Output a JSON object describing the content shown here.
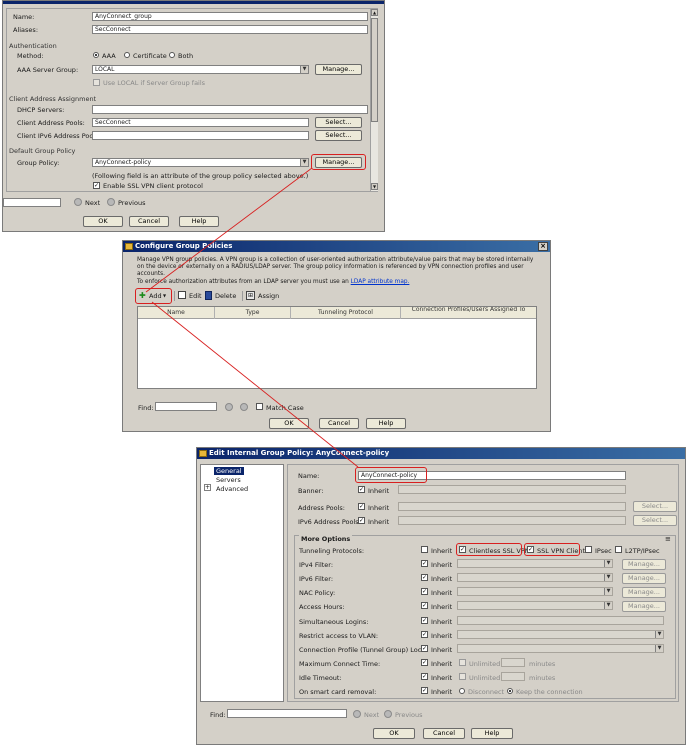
{
  "top_dialog": {
    "fields": {
      "name_label": "Name:",
      "name_value": "AnyConnect_group",
      "aliases_label": "Aliases:",
      "aliases_value": "SecConnect"
    },
    "authentication": {
      "section": "Authentication",
      "method_label": "Method:",
      "method_options": [
        "AAA",
        "Certificate",
        "Both"
      ],
      "method_selected": "AAA",
      "aaa_group_label": "AAA Server Group:",
      "aaa_group_value": "LOCAL",
      "manage_label": "Manage...",
      "fallback_label": "Use LOCAL if Server Group fails"
    },
    "client_address": {
      "section": "Client Address Assignment",
      "dhcp_label": "DHCP Servers:",
      "dhcp_value": "",
      "pools_label": "Client Address Pools:",
      "pools_value": "SecConnect",
      "ipv6_label": "Client IPv6 Address Pools:",
      "ipv6_value": "",
      "select_label": "Select..."
    },
    "default_group_policy": {
      "section": "Default Group Policy",
      "policy_label": "Group Policy:",
      "policy_value": "AnyConnect-policy",
      "manage_label": "Manage...",
      "note": "(Following field is an attribute of the group policy selected above.)",
      "ssl_label": "Enable SSL VPN client protocol"
    },
    "find": {
      "next_label": "Next",
      "previous_label": "Previous"
    },
    "buttons": {
      "ok": "OK",
      "cancel": "Cancel",
      "help": "Help"
    }
  },
  "group_policies": {
    "title": "Configure Group Policies",
    "description": "Manage VPN group policies. A VPN group is a collection of user-oriented authorization attribute/value pairs that may be stored internally on the device or externally on a RADIUS/LDAP server. The group policy information is referenced by VPN connection profiles and user accounts.",
    "ldap_text": "To enforce authorization attributes from an LDAP server you must use an",
    "ldap_link": "LDAP attribute map.",
    "toolbar": {
      "add": "Add",
      "edit": "Edit",
      "delete": "Delete",
      "assign": "Assign"
    },
    "columns": [
      "Name",
      "Type",
      "Tunneling Protocol",
      "Connection Profiles/Users Assigned To"
    ],
    "find_label": "Find:",
    "match_case": "Match Case",
    "buttons": {
      "ok": "OK",
      "cancel": "Cancel",
      "help": "Help"
    }
  },
  "edit_policy": {
    "title": "Edit Internal Group Policy: AnyConnect-policy",
    "nav": {
      "general": "General",
      "servers": "Servers",
      "advanced": "Advanced"
    },
    "name_label": "Name:",
    "name_value": "AnyConnect-policy",
    "banner_label": "Banner:",
    "address_pools_label": "Address Pools:",
    "ipv6_pools_label": "IPv6 Address Pools:",
    "inherit": "Inherit",
    "select": "Select...",
    "manage": "Manage...",
    "more_options": "More Options",
    "rows": {
      "tunneling": "Tunneling Protocols:",
      "ipv4": "IPv4 Filter:",
      "ipv6": "IPv6 Filter:",
      "nac": "NAC Policy:",
      "access_hours": "Access Hours:",
      "simultaneous": "Simultaneous Logins:",
      "vlan": "Restrict access to VLAN:",
      "lock": "Connection Profile (Tunnel Group) Lock:",
      "max_time": "Maximum Connect Time:",
      "idle": "Idle Timeout:",
      "smart_card": "On smart card removal:"
    },
    "protocols": {
      "clientless": "Clientless SSL VPN",
      "ssl_client": "SSL VPN Client",
      "ipsec": "IPsec",
      "l2tp": "L2TP/IPsec"
    },
    "unlimited": "Unlimited",
    "minutes": "minutes",
    "disconnect": "Disconnect",
    "keep": "Keep the connection",
    "find_label": "Find:",
    "next_label": "Next",
    "previous_label": "Previous",
    "buttons": {
      "ok": "OK",
      "cancel": "Cancel",
      "help": "Help"
    }
  },
  "colors": {
    "highlight": "#d82020",
    "titlebar": "#0a246a",
    "dialog_bg": "#d4d0c8"
  }
}
